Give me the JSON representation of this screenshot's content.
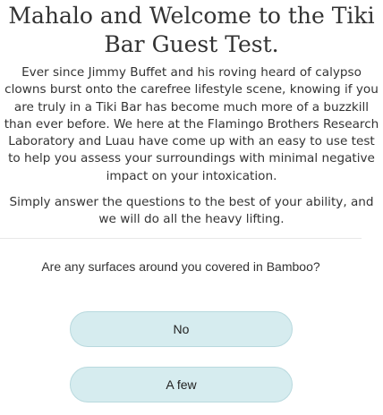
{
  "header": {
    "title": "Mahalo and Welcome to the Tiki Bar Guest Test."
  },
  "intro": {
    "paragraph1": "Ever since Jimmy Buffet and his roving heard of calypso clowns burst onto the carefree lifestyle scene, knowing if you are truly in a Tiki Bar has become much more of a buzzkill than ever before. We here at the Flamingo Brothers Research Laboratory and Luau have come up with an easy to use test to help you assess your surroundings with minimal negative impact on your intoxication.",
    "paragraph2": "Simply answer the questions to the best of your ability, and we will do all the heavy lifting."
  },
  "quiz": {
    "question": "Are any surfaces around you covered in Bamboo?",
    "answers": [
      {
        "label": "No"
      },
      {
        "label": "A few"
      }
    ]
  }
}
